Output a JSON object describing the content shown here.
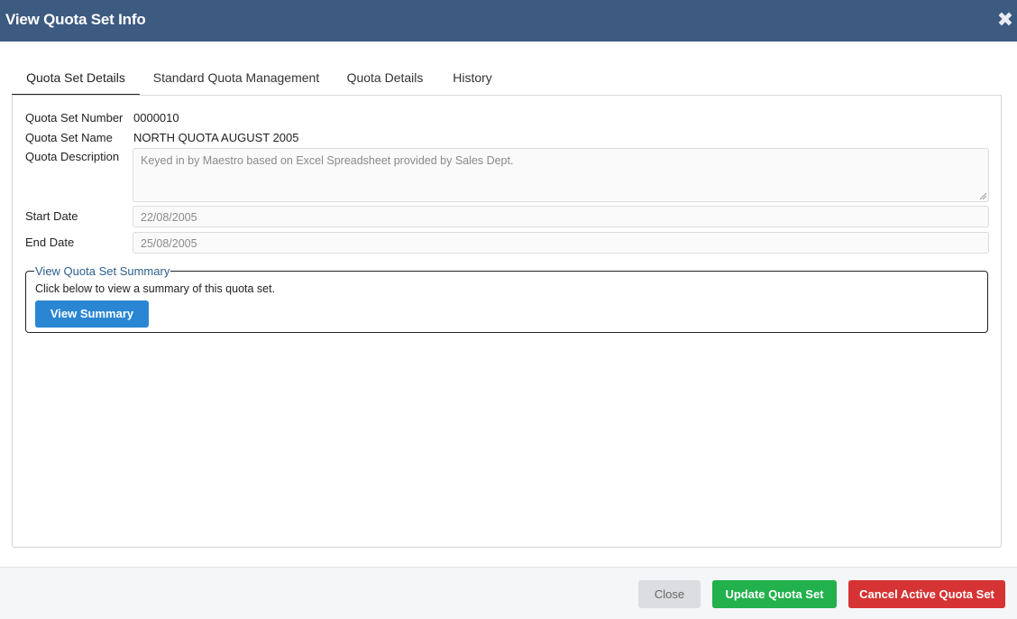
{
  "window": {
    "title": "View Quota Set Info",
    "close_icon": "close-icon"
  },
  "tabs": [
    {
      "label": "Quota Set Details",
      "active": true
    },
    {
      "label": "Standard Quota Management",
      "active": false
    },
    {
      "label": "Quota Details",
      "active": false
    },
    {
      "label": "History",
      "active": false
    }
  ],
  "details": {
    "number_label": "Quota Set Number",
    "number_value": "0000010",
    "name_label": "Quota Set Name",
    "name_value": "NORTH QUOTA AUGUST 2005",
    "description_label": "Quota Description",
    "description_value": "Keyed in by Maestro based on Excel Spreadsheet provided by Sales Dept.",
    "start_label": "Start Date",
    "start_value": "22/08/2005",
    "end_label": "End Date",
    "end_value": "25/08/2005"
  },
  "summary": {
    "legend": "View Quota Set Summary",
    "text": "Click below to view a summary of this quota set.",
    "button": "View Summary"
  },
  "footer": {
    "close": "Close",
    "update": "Update Quota Set",
    "cancel": "Cancel Active Quota Set"
  },
  "colors": {
    "titlebar": "#3d5a80",
    "primary_button": "#2a86d3",
    "update_button": "#22b14c",
    "cancel_button": "#d63334"
  }
}
